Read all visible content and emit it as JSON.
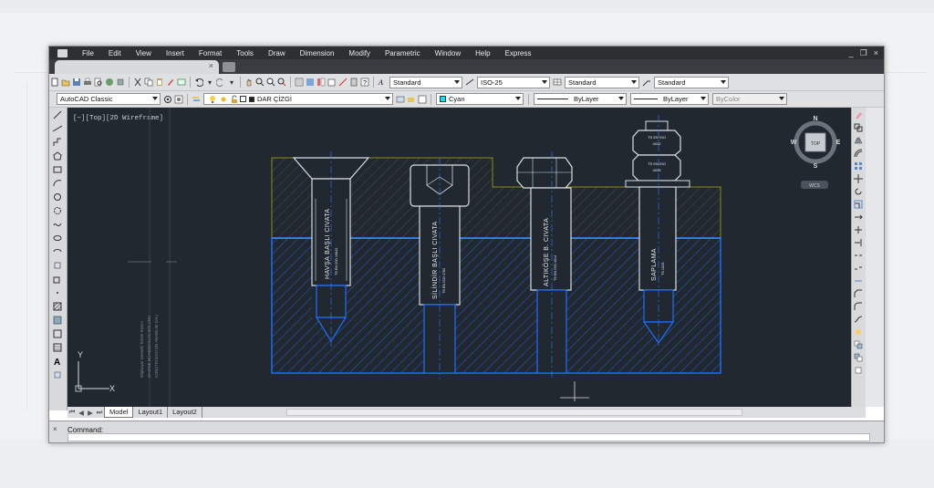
{
  "menu": {
    "items": [
      "File",
      "Edit",
      "View",
      "Insert",
      "Format",
      "Tools",
      "Draw",
      "Dimension",
      "Modify",
      "Parametric",
      "Window",
      "Help",
      "Express"
    ],
    "window_controls": [
      "_",
      "❐",
      "×"
    ]
  },
  "toolbar2": {
    "text_style": "Standard",
    "dim_style": "ISO-25",
    "table_style": "Standard",
    "mleader_style": "Standard"
  },
  "toolbar3": {
    "workspace": "AutoCAD Classic",
    "layer": "DAR ÇİZGİ",
    "color": "Cyan",
    "linetype": "ByLayer",
    "lineweight": "ByLayer",
    "plotstyle": "ByColor"
  },
  "viewport": {
    "label": "[−][Top][2D Wireframe]"
  },
  "viewcube": {
    "n": "N",
    "s": "S",
    "e": "E",
    "w": "W",
    "face": "TOP",
    "wcs": "WCS"
  },
  "ucs": {
    "x": "X",
    "y": "Y"
  },
  "drawing": {
    "bolts": [
      {
        "title": "HAVŞA BAŞLI CIVATA",
        "spec": "TS EN ISO 10642"
      },
      {
        "title": "SİLİNDİR BAŞLI CIVATA",
        "spec": "TS EN ISO 4762"
      },
      {
        "title": "ALTIKÖŞE B. CIVATA",
        "spec": "TS EN ISO 4014"
      },
      {
        "title": "SAPLAMA",
        "spec": "TS 1025"
      }
    ],
    "nuts": [
      {
        "line1": "TS EN ISO",
        "line2": "4032"
      },
      {
        "line1": "TS EN ISO",
        "line2": "4035"
      }
    ],
    "side_text": [
      "Bilgisayar Destekli Teknik Resim",
      "MAKİNE MÜHENDİSLİĞİ BÖLÜMÜ",
      "KONSTRÜKSİYON ANABİLİM DALI"
    ]
  },
  "layout_tabs": [
    "Model",
    "Layout1",
    "Layout2"
  ],
  "command": {
    "label": "Command:"
  },
  "colors": {
    "canvas": "#212830",
    "hatch_blue": "#1e6fff",
    "outline": "#d8dde2",
    "olive": "#8a8a1c",
    "center_line": "#2f7fff"
  }
}
